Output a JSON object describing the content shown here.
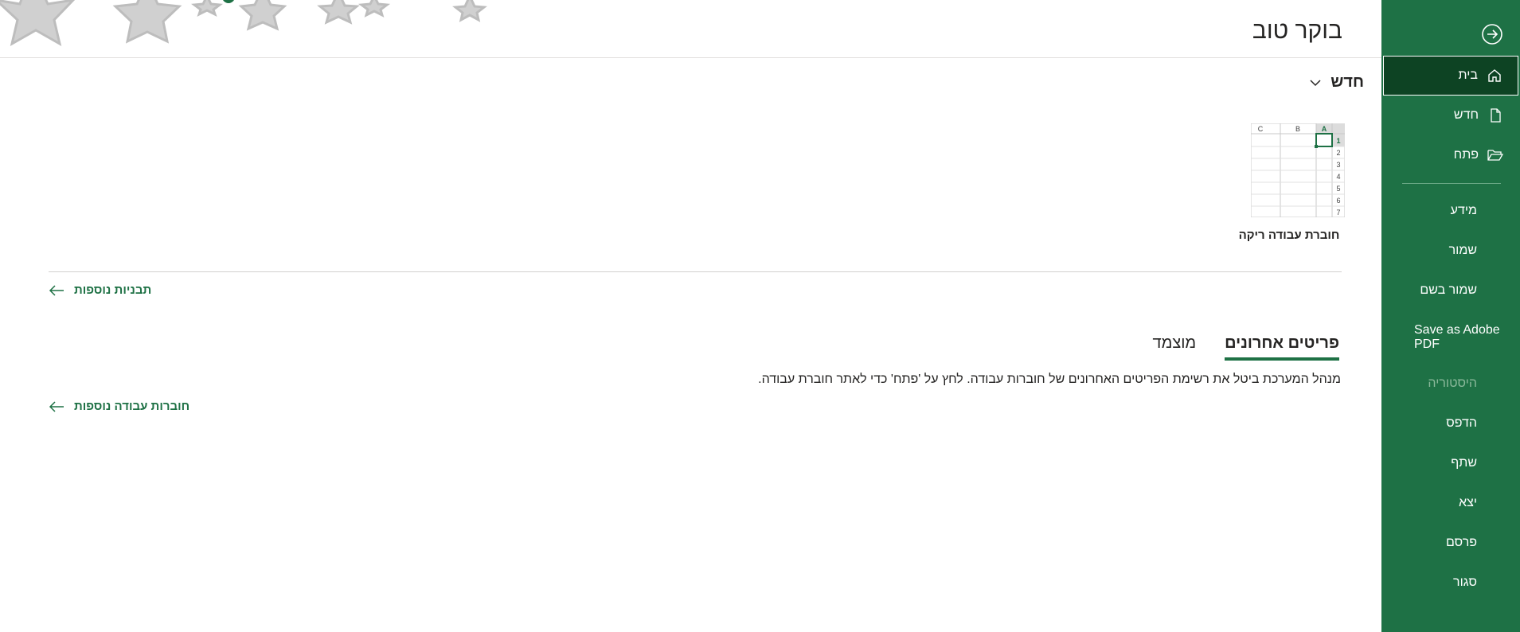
{
  "colors": {
    "accent": "#1e7145",
    "sidebar_active": "#0d4323"
  },
  "sidebar": {
    "items": [
      {
        "label": "בית",
        "icon": "home-icon",
        "active": true
      },
      {
        "label": "חדש",
        "icon": "new-document-icon"
      },
      {
        "label": "פתח",
        "icon": "open-folder-icon"
      },
      {
        "label": "מידע"
      },
      {
        "label": "שמור"
      },
      {
        "label": "שמור בשם"
      },
      {
        "label": "Save as Adobe PDF"
      },
      {
        "label": "היסטוריה",
        "disabled": true
      },
      {
        "label": "הדפס"
      },
      {
        "label": "שתף"
      },
      {
        "label": "יצא"
      },
      {
        "label": "פרסם"
      },
      {
        "label": "סגור"
      }
    ]
  },
  "header": {
    "greeting": "בוקר טוב"
  },
  "new_section": {
    "title": "חדש",
    "blank_workbook_label": "חוברת עבודה ריקה",
    "thumbnail": {
      "columns": [
        "C",
        "B",
        "A"
      ],
      "rows": [
        "1",
        "2",
        "3",
        "4",
        "5",
        "6",
        "7"
      ]
    },
    "more_templates_link": "תבניות נוספות"
  },
  "recent": {
    "tabs": [
      {
        "label": "פריטים אחרונים",
        "active": true
      },
      {
        "label": "מוצמד"
      }
    ],
    "notice": "מנהל המערכת ביטל את רשימת הפריטים האחרונים של חוברות עבודה. לחץ על 'פתח' כדי לאתר חוברת עבודה.",
    "more_workbooks_link": "חוברות עבודה נוספות"
  }
}
